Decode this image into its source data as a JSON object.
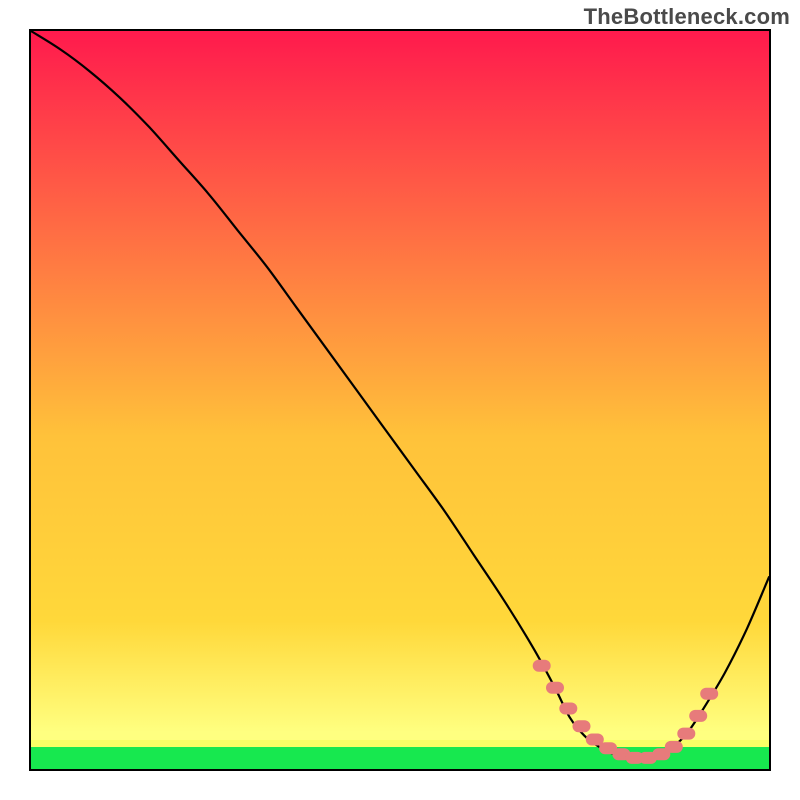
{
  "watermark": {
    "text": "TheBottleneck.com"
  },
  "chart_data": {
    "type": "line",
    "title": "",
    "xlabel": "",
    "ylabel": "",
    "xlim": [
      0,
      100
    ],
    "ylim": [
      0,
      100
    ],
    "grid": false,
    "legend": false,
    "series": [
      {
        "name": "bottleneck-curve",
        "x": [
          0,
          4,
          8,
          12,
          16,
          20,
          24,
          28,
          32,
          36,
          40,
          44,
          48,
          52,
          56,
          60,
          64,
          68,
          71,
          73,
          75,
          77,
          79,
          81,
          83,
          85,
          87,
          89,
          91,
          94,
          97,
          100
        ],
        "y": [
          100,
          97.5,
          94.5,
          91,
          87,
          82.5,
          78,
          73,
          68,
          62.5,
          57,
          51.5,
          46,
          40.5,
          35,
          29,
          23,
          16.5,
          11,
          7,
          4.5,
          3,
          2,
          1.5,
          1.5,
          2,
          3,
          5,
          8,
          13,
          19,
          26
        ]
      },
      {
        "name": "optimal-segment-markers",
        "x": [
          69.2,
          71.0,
          72.8,
          74.6,
          76.4,
          78.2,
          80.0,
          81.8,
          83.6,
          85.4,
          87.1,
          88.8,
          90.4,
          91.9
        ],
        "y": [
          14.0,
          11.0,
          8.2,
          5.8,
          4.0,
          2.8,
          2.0,
          1.5,
          1.5,
          2.0,
          3.0,
          4.8,
          7.2,
          10.2
        ]
      },
      {
        "name": "optimal-band",
        "x": [
          0,
          100
        ],
        "y": [
          0,
          3
        ],
        "note": "green horizontal band along baseline representing zero-bottleneck range"
      }
    ],
    "gradient": {
      "top_color": "#ff1a4d",
      "mid_color": "#ffd83a",
      "bottom_color": "#ffff80",
      "band_color": "#17e84f"
    }
  }
}
